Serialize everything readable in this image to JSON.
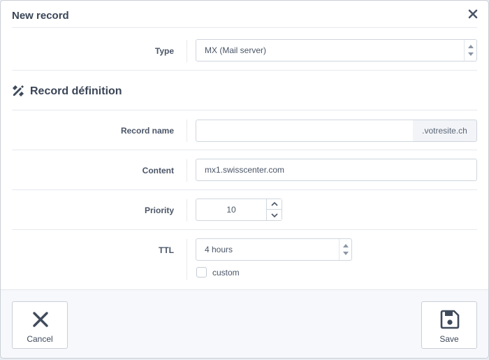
{
  "modal": {
    "title": "New record"
  },
  "type_field": {
    "label": "Type",
    "value": "MX (Mail server)"
  },
  "section": {
    "title": "Record définition"
  },
  "record_name": {
    "label": "Record name",
    "value": "",
    "suffix": ".votresite.ch"
  },
  "content": {
    "label": "Content",
    "value": "mx1.swisscenter.com"
  },
  "priority": {
    "label": "Priority",
    "value": "10"
  },
  "ttl": {
    "label": "TTL",
    "value": "4 hours",
    "custom_label": "custom",
    "custom_checked": false
  },
  "footer": {
    "cancel_label": "Cancel",
    "save_label": "Save"
  },
  "icons": {
    "close": "close-icon",
    "section": "pen-ruler-icon",
    "cancel": "x-icon",
    "save": "floppy-disk-icon"
  }
}
